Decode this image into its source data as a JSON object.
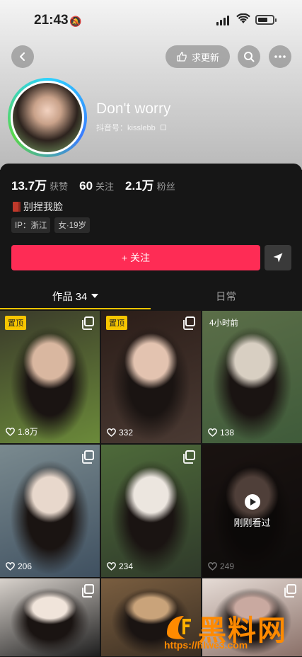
{
  "status_bar": {
    "time": "21:43"
  },
  "header": {
    "update_label": "求更新"
  },
  "profile": {
    "name": "Don't worry",
    "handle_label": "抖音号：kisslebb",
    "stats": [
      {
        "value": "13.7万",
        "label": "获赞"
      },
      {
        "value": "60",
        "label": "关注"
      },
      {
        "value": "2.1万",
        "label": "粉丝"
      }
    ],
    "bio": "别捏我脸",
    "tags": [
      "IP：浙江",
      "女·19岁"
    ],
    "follow_label": "+ 关注"
  },
  "tabs": [
    {
      "label": "作品 34"
    },
    {
      "label": "日常"
    }
  ],
  "grid": [
    {
      "badge": "置顶",
      "likes": "1.8万",
      "colors": [
        "#3a3a2a",
        "#d9b7a0",
        "#6b8a3a"
      ]
    },
    {
      "badge": "置顶",
      "likes": "332",
      "colors": [
        "#2b1d18",
        "#e3c3b0",
        "#4a3a33"
      ]
    },
    {
      "time": "4小时前",
      "likes": "138",
      "colors": [
        "#5b6e48",
        "#d8cfc2",
        "#3f5b3a"
      ]
    },
    {
      "likes": "206",
      "colors": [
        "#7a8a8f",
        "#e8d8cc",
        "#3f5060"
      ]
    },
    {
      "likes": "234",
      "colors": [
        "#4e6a3a",
        "#ece6df",
        "#2f3a2a"
      ]
    },
    {
      "likes": "249",
      "watched": "刚刚看过",
      "colors": [
        "#3a2a26",
        "#b08c7e",
        "#1e1a18"
      ]
    },
    {
      "likes": "",
      "colors": [
        "#d8d2cc",
        "#f0e4da",
        "#1e1e1e"
      ]
    },
    {
      "likes": "",
      "colors": [
        "#7a5e40",
        "#c9a37a",
        "#3a2e22"
      ]
    },
    {
      "likes": "",
      "colors": [
        "#e6dcd6",
        "#c9a9a0",
        "#8a7068"
      ]
    }
  ],
  "watermark": {
    "text": "黑料网",
    "url": "https://hlwe3.com"
  },
  "colors": {
    "accent": "#fe2c55",
    "pin": "#f6c500",
    "watermark": "#ff8a00"
  }
}
